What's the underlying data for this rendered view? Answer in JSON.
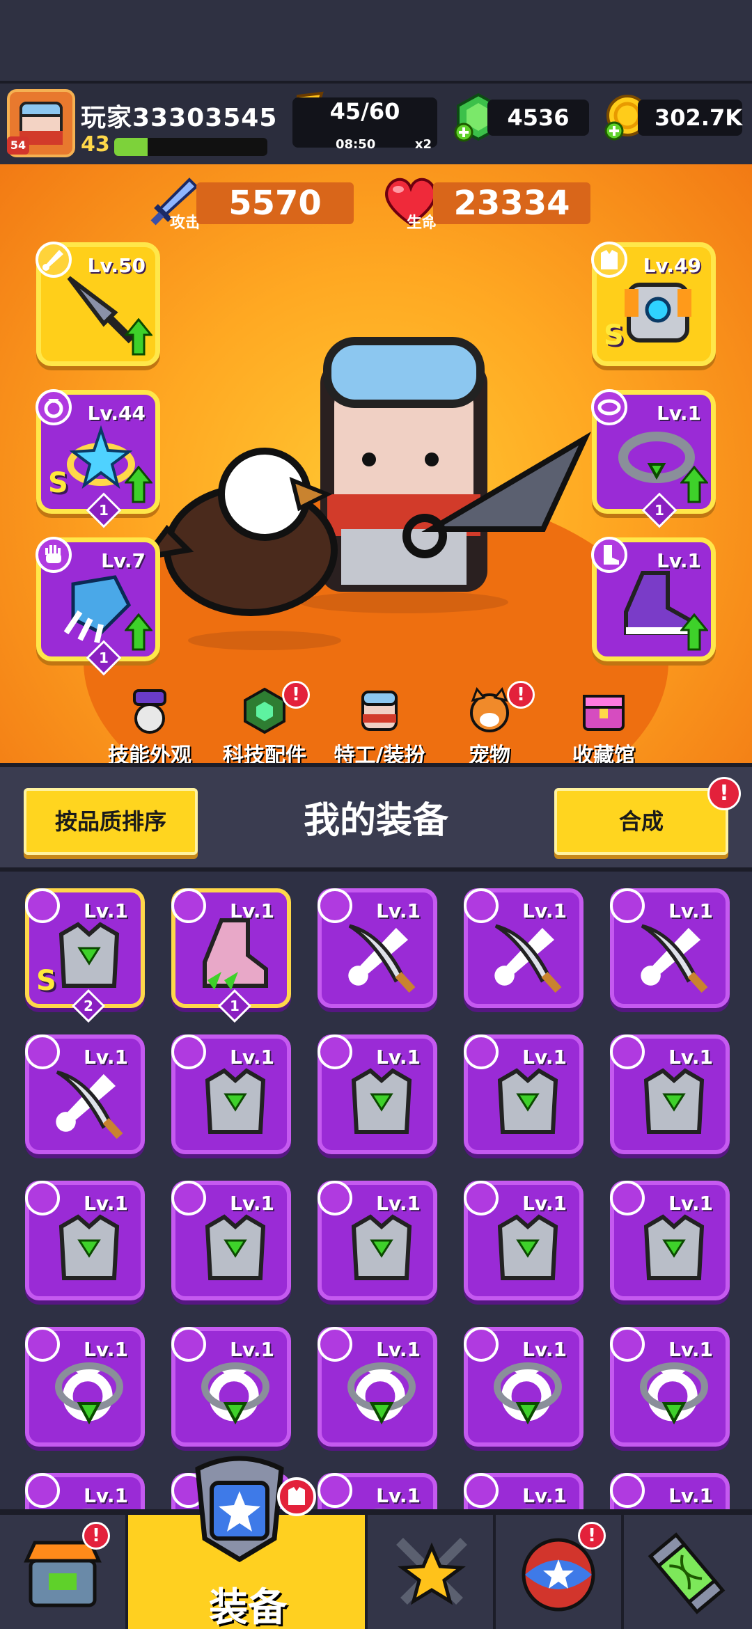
{
  "player": {
    "name": "玩家33303545",
    "level": "43",
    "avatar_level": "54",
    "xp_fraction": 0.22
  },
  "resources": {
    "energy": "45/60",
    "energy_timer": "08:50",
    "energy_mult": "x2",
    "gems": "4536",
    "coins": "302.7K"
  },
  "stats": {
    "attack_label": "攻击",
    "attack_value": "5570",
    "hp_label": "生命",
    "hp_value": "23334"
  },
  "slots": {
    "weapon": {
      "level": "Lv.50"
    },
    "ring": {
      "level": "Lv.44",
      "stars": "1",
      "rank": "S"
    },
    "glove": {
      "level": "Lv.7",
      "stars": "1"
    },
    "armor": {
      "level": "Lv.49",
      "rank": "S"
    },
    "belt": {
      "level": "Lv.1",
      "stars": "1"
    },
    "boots": {
      "level": "Lv.1"
    }
  },
  "hero_nav": [
    {
      "label": "技能外观"
    },
    {
      "label": "科技配件",
      "alert": "!"
    },
    {
      "label": "特工/装扮"
    },
    {
      "label": "宠物",
      "alert": "!"
    },
    {
      "label": "收藏馆"
    }
  ],
  "equip_header": {
    "title": "我的装备",
    "sort_label": "按品质排序",
    "merge_label": "合成",
    "merge_alert": "!"
  },
  "inventory": [
    {
      "level": "Lv.1",
      "type": "armor",
      "rank": "S",
      "stars": "2"
    },
    {
      "level": "Lv.1",
      "type": "boots",
      "stars": "1"
    },
    {
      "level": "Lv.1",
      "type": "weapon"
    },
    {
      "level": "Lv.1",
      "type": "weapon"
    },
    {
      "level": "Lv.1",
      "type": "weapon"
    },
    {
      "level": "Lv.1",
      "type": "weapon"
    },
    {
      "level": "Lv.1",
      "type": "armor"
    },
    {
      "level": "Lv.1",
      "type": "armor"
    },
    {
      "level": "Lv.1",
      "type": "armor"
    },
    {
      "level": "Lv.1",
      "type": "armor"
    },
    {
      "level": "Lv.1",
      "type": "armor"
    },
    {
      "level": "Lv.1",
      "type": "armor"
    },
    {
      "level": "Lv.1",
      "type": "armor"
    },
    {
      "level": "Lv.1",
      "type": "armor"
    },
    {
      "level": "Lv.1",
      "type": "armor"
    },
    {
      "level": "Lv.1",
      "type": "necklace"
    },
    {
      "level": "Lv.1",
      "type": "necklace"
    },
    {
      "level": "Lv.1",
      "type": "necklace"
    },
    {
      "level": "Lv.1",
      "type": "necklace"
    },
    {
      "level": "Lv.1",
      "type": "necklace"
    },
    {
      "level": "Lv.1",
      "type": "necklace"
    },
    {
      "level": "Lv.1",
      "type": "necklace"
    },
    {
      "level": "Lv.1",
      "type": "necklace"
    },
    {
      "level": "Lv.1",
      "type": "necklace"
    },
    {
      "level": "Lv.1",
      "type": "belt"
    }
  ],
  "bottom_nav": {
    "active_label": "装备",
    "shop_alert": "!",
    "gacha_alert": "!"
  },
  "colors": {
    "accent": "#ffd020",
    "purple": "#9a2bd6",
    "orange": "#f27a14",
    "alert": "#e3213b"
  }
}
